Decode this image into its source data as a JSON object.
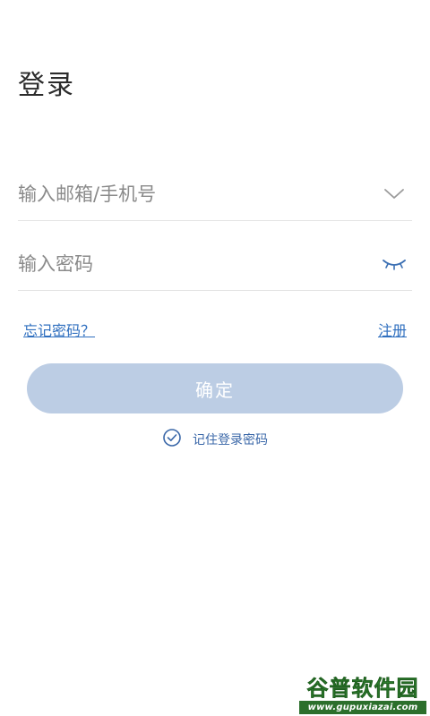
{
  "header": {
    "title": "登录"
  },
  "form": {
    "account_placeholder": "输入邮箱/手机号",
    "account_value": "",
    "account_icon": "chevron-down-icon",
    "password_placeholder": "输入密码",
    "password_value": "",
    "password_icon": "eye-closed-icon"
  },
  "links": {
    "forgot_password": "忘记密码？",
    "register": "注册"
  },
  "actions": {
    "confirm_label": "确定"
  },
  "remember": {
    "label": "记住登录密码",
    "checked": true,
    "icon": "check-circle-icon"
  },
  "watermark": {
    "title": "谷普软件园",
    "url": "www.gupuxiazai.com"
  },
  "colors": {
    "accent": "#2f6fbf",
    "button_disabled": "#bccde4",
    "divider": "#e3e3e3"
  }
}
